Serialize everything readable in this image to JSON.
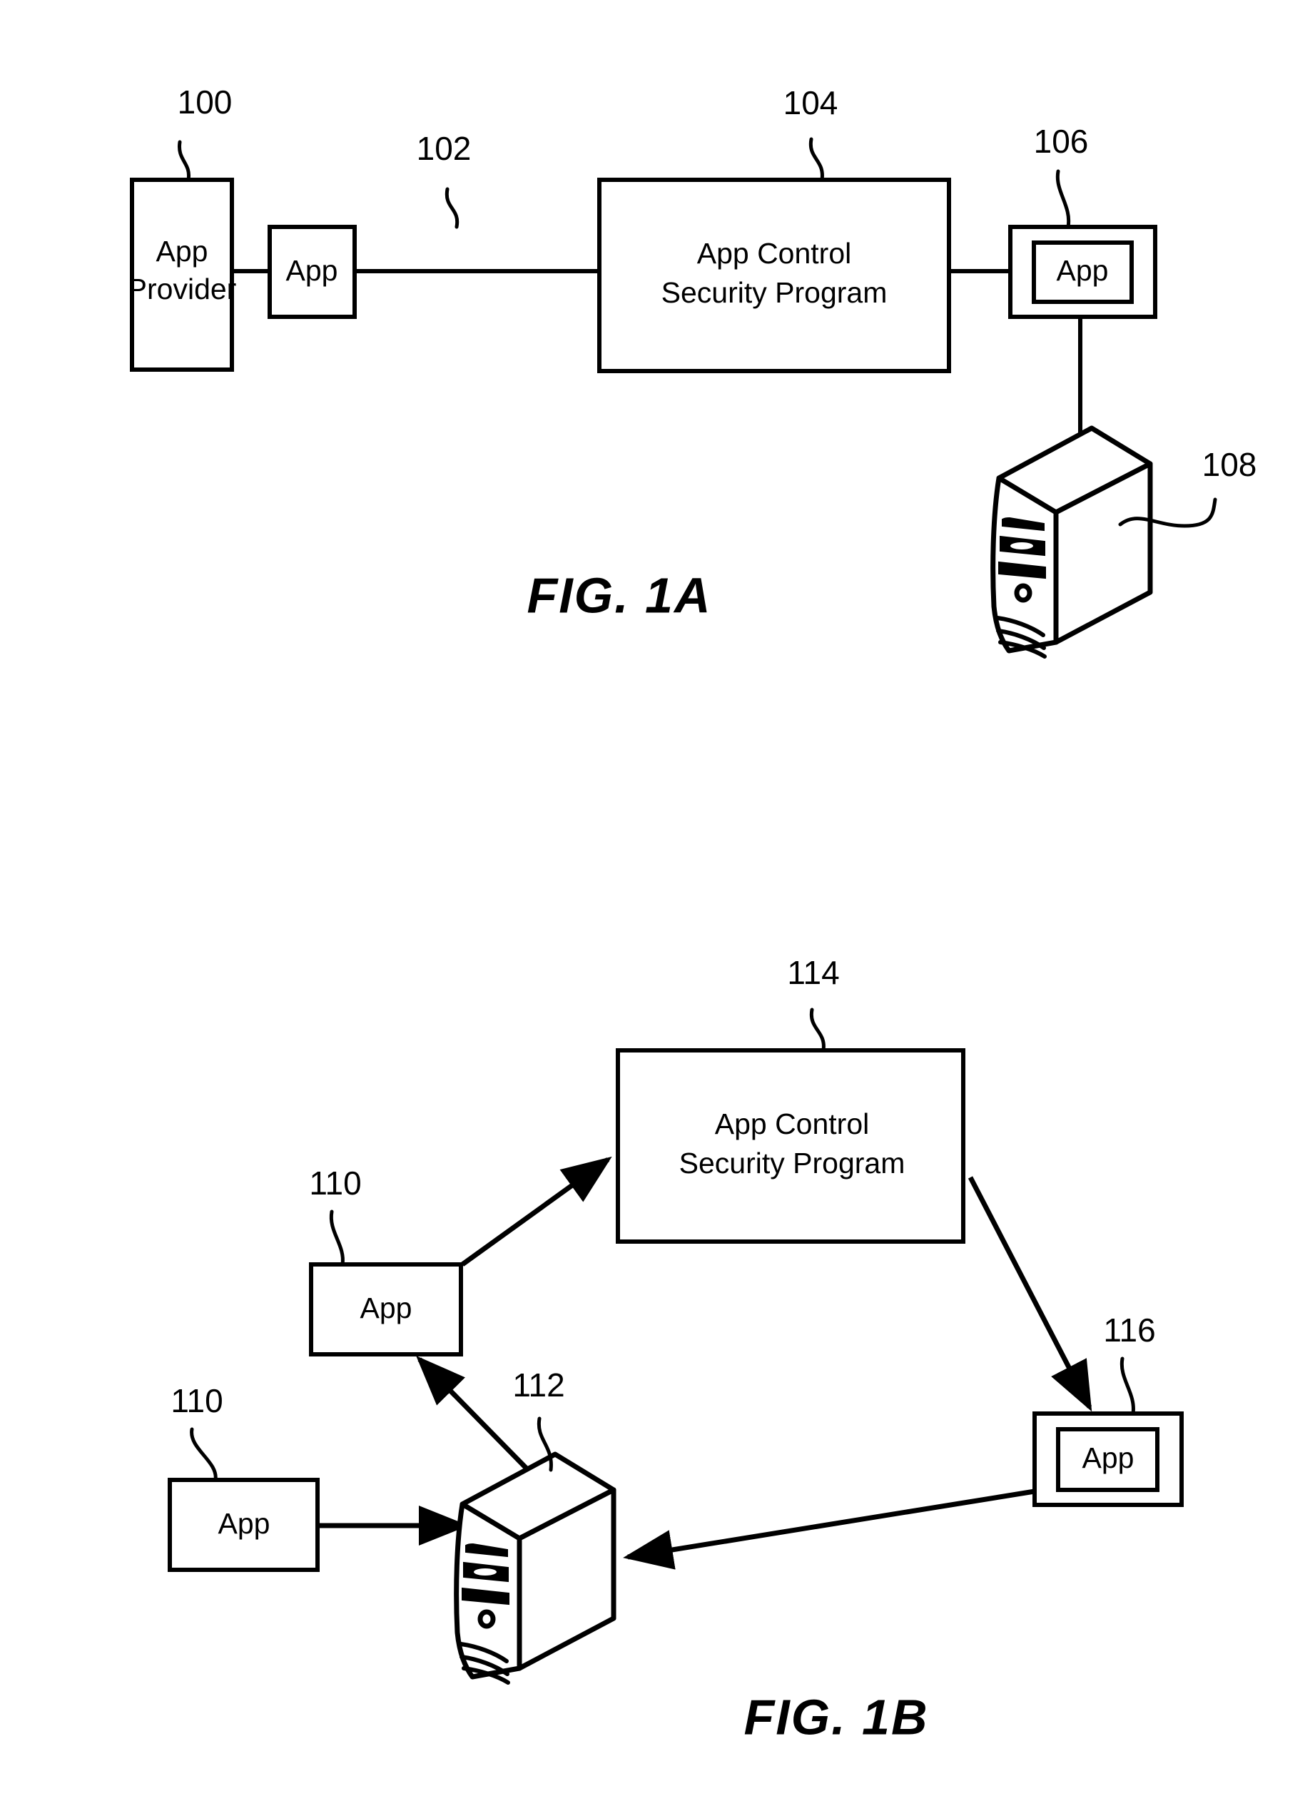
{
  "figures": [
    {
      "id": "fig-1a",
      "caption": "FIG. 1A",
      "nodes": [
        {
          "ref": "100",
          "label_line1": "App",
          "label_line2": "Provider",
          "kind": "box"
        },
        {
          "ref": "102",
          "label_line1": "App",
          "label_line2": "",
          "kind": "box"
        },
        {
          "ref": "104",
          "label_line1": "App Control",
          "label_line2": "Security Program",
          "kind": "box"
        },
        {
          "ref": "106",
          "label_line1": "App",
          "label_line2": "",
          "kind": "double-box"
        },
        {
          "ref": "108",
          "label_line1": "",
          "label_line2": "",
          "kind": "server"
        }
      ]
    },
    {
      "id": "fig-1b",
      "caption": "FIG. 1B",
      "nodes": [
        {
          "ref": "114",
          "label_line1": "App Control",
          "label_line2": "Security Program",
          "kind": "box"
        },
        {
          "ref": "110",
          "label_line1": "App",
          "label_line2": "",
          "kind": "box"
        },
        {
          "ref": "110",
          "label_line1": "App",
          "label_line2": "",
          "kind": "box"
        },
        {
          "ref": "112",
          "label_line1": "",
          "label_line2": "",
          "kind": "server"
        },
        {
          "ref": "116",
          "label_line1": "App",
          "label_line2": "",
          "kind": "double-box"
        }
      ]
    }
  ],
  "fig1a": {
    "caption": "FIG. 1A",
    "app_provider": {
      "ref": "100",
      "line1": "App",
      "line2": "Provider"
    },
    "app_102": {
      "ref": "102",
      "line1": "App"
    },
    "security_program": {
      "ref": "104",
      "line1": "App Control",
      "line2": "Security Program"
    },
    "app_106": {
      "ref": "106",
      "line1": "App"
    },
    "server_108": {
      "ref": "108"
    }
  },
  "fig1b": {
    "caption": "FIG. 1B",
    "security_program": {
      "ref": "114",
      "line1": "App Control",
      "line2": "Security Program"
    },
    "app_110_upper": {
      "ref": "110",
      "line1": "App"
    },
    "app_110_lower": {
      "ref": "110",
      "line1": "App"
    },
    "server_112": {
      "ref": "112"
    },
    "app_116": {
      "ref": "116",
      "line1": "App"
    }
  },
  "colors": {
    "ink": "#000000",
    "paper": "#ffffff"
  }
}
